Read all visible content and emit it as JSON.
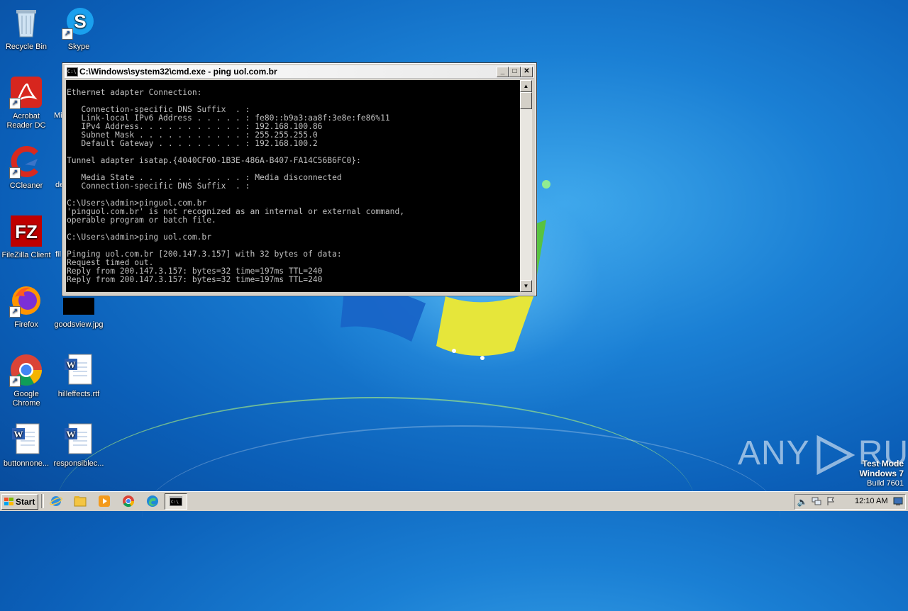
{
  "desktop": {
    "icons": [
      {
        "label": "Recycle Bin"
      },
      {
        "label": "Skype"
      },
      {
        "label": "Acrobat Reader DC"
      },
      {
        "label": "CCleaner"
      },
      {
        "label": "FileZilla Client"
      },
      {
        "label": "Firefox"
      },
      {
        "label": "goodsview.jpg"
      },
      {
        "label": "Google Chrome"
      },
      {
        "label": "hilleffects.rtf"
      },
      {
        "label": "buttonnone..."
      },
      {
        "label": "responsiblec..."
      }
    ],
    "partial_labels": [
      "Mi",
      "de",
      "fil"
    ]
  },
  "cmd": {
    "title": "C:\\Windows\\system32\\cmd.exe - ping  uol.com.br",
    "icon_text": "C:\\",
    "minimize": "_",
    "maximize": "□",
    "close": "✕",
    "lines": [
      "",
      "Ethernet adapter Connection:",
      "",
      "   Connection-specific DNS Suffix  . :",
      "   Link-local IPv6 Address . . . . . : fe80::b9a3:aa8f:3e8e:fe86%11",
      "   IPv4 Address. . . . . . . . . . . : 192.168.100.86",
      "   Subnet Mask . . . . . . . . . . . : 255.255.255.0",
      "   Default Gateway . . . . . . . . . : 192.168.100.2",
      "",
      "Tunnel adapter isatap.{4040CF00-1B3E-486A-B407-FA14C56B6FC0}:",
      "",
      "   Media State . . . . . . . . . . . : Media disconnected",
      "   Connection-specific DNS Suffix  . :",
      "",
      "C:\\Users\\admin>pinguol.com.br",
      "'pinguol.com.br' is not recognized as an internal or external command,",
      "operable program or batch file.",
      "",
      "C:\\Users\\admin>ping uol.com.br",
      "",
      "Pinging uol.com.br [200.147.3.157] with 32 bytes of data:",
      "Request timed out.",
      "Reply from 200.147.3.157: bytes=32 time=197ms TTL=240",
      "Reply from 200.147.3.157: bytes=32 time=197ms TTL=240"
    ]
  },
  "watermark": {
    "left": "ANY",
    "right": "RUN"
  },
  "os_info": {
    "line1": "Test Mode",
    "line2": "Windows 7",
    "line3": "Build 7601"
  },
  "taskbar": {
    "start_label": "Start",
    "clock": "12:10 AM"
  }
}
